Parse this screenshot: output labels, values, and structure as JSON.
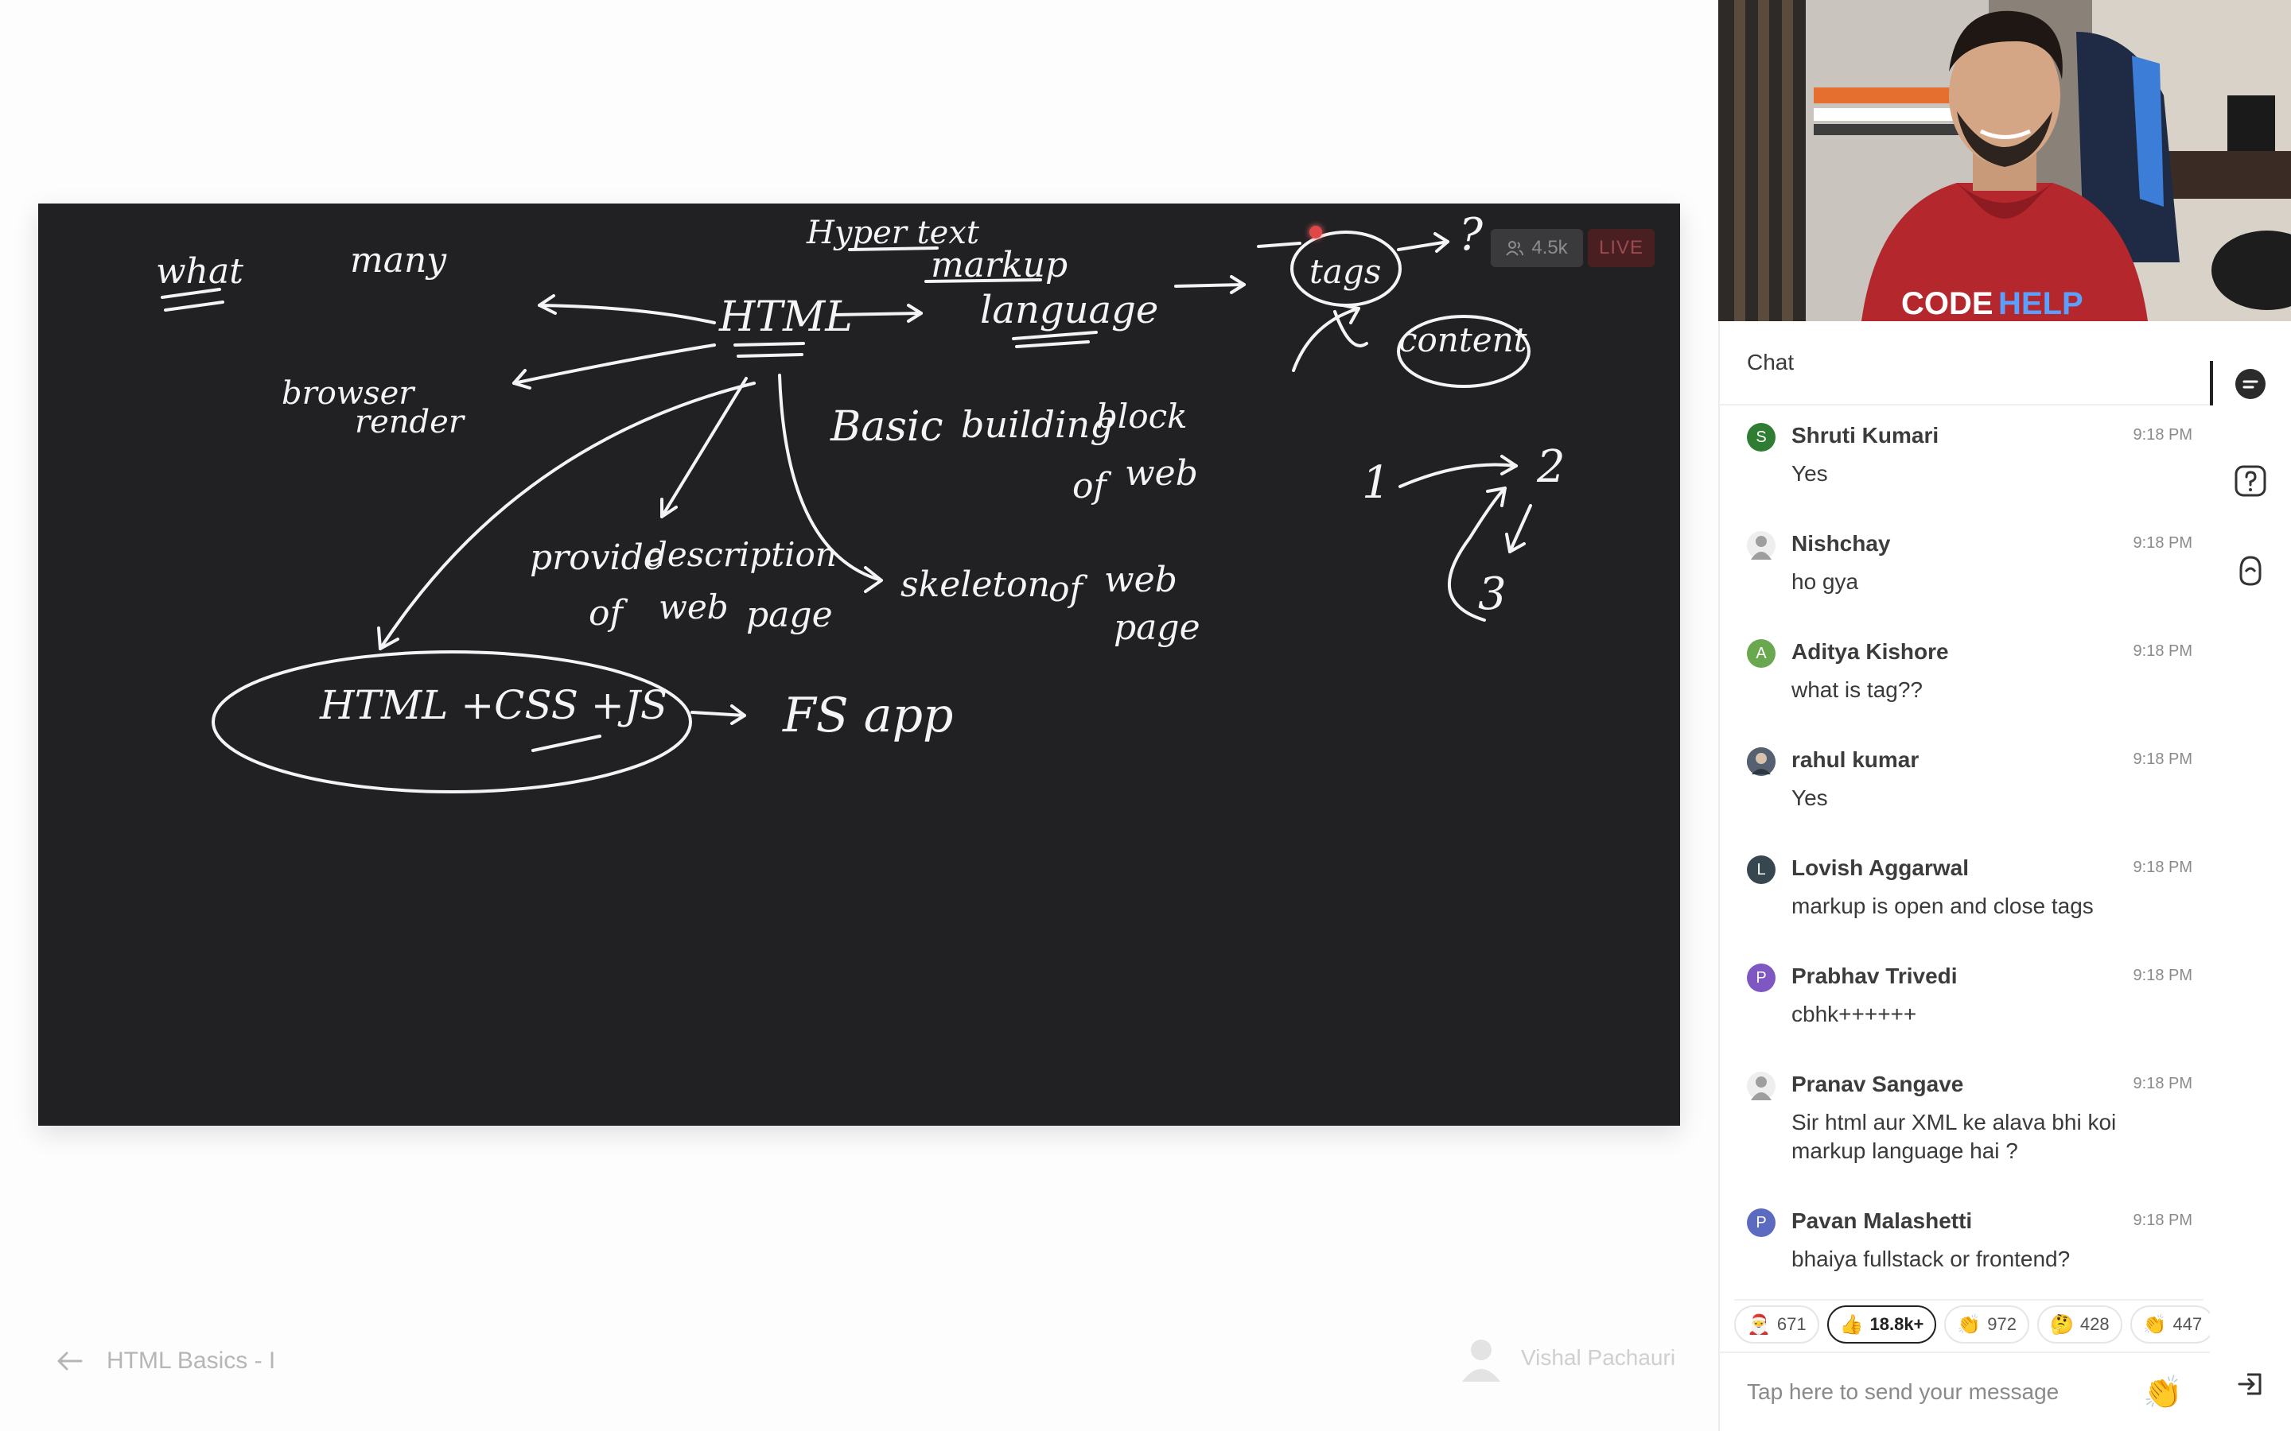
{
  "board": {
    "viewer_count": "4.5k",
    "live_label": "LIVE"
  },
  "lesson": {
    "title": "HTML Basics - I",
    "instructor": "Vishal Pachauri"
  },
  "video": {
    "logo_text_left": "CODE",
    "logo_text_right": "HELP"
  },
  "chat": {
    "title": "Chat",
    "messages": [
      {
        "initial": "S",
        "name": "Shruti Kumari",
        "time": "9:18 PM",
        "text": "Yes",
        "color": "#2e7d32"
      },
      {
        "initial": "",
        "name": "Nishchay",
        "time": "9:18 PM",
        "text": "ho gya",
        "color": "#9e9e9e"
      },
      {
        "initial": "A",
        "name": "Aditya Kishore",
        "time": "9:18 PM",
        "text": "what is tag??",
        "color": "#6aa84f"
      },
      {
        "initial": "",
        "name": "rahul kumar",
        "time": "9:18 PM",
        "text": "Yes",
        "color": "#556070"
      },
      {
        "initial": "L",
        "name": "Lovish Aggarwal",
        "time": "9:18 PM",
        "text": "markup is open and close tags",
        "color": "#37474f"
      },
      {
        "initial": "P",
        "name": "Prabhav Trivedi",
        "time": "9:18 PM",
        "text": "cbhk++++++",
        "color": "#7e57c2"
      },
      {
        "initial": "",
        "name": "Pranav Sangave",
        "time": "9:18 PM",
        "text": "Sir html aur XML ke alava bhi koi markup language hai ?",
        "color": "#9e9e9e"
      },
      {
        "initial": "P",
        "name": "Pavan Malashetti",
        "time": "9:18 PM",
        "text": "bhaiya fullstack or frontend?",
        "color": "#5c6bc0"
      }
    ],
    "reactions": [
      {
        "emoji": "🎅",
        "count": "671"
      },
      {
        "emoji": "👍",
        "count": "18.8k+"
      },
      {
        "emoji": "👏",
        "count": "972"
      },
      {
        "emoji": "🤔",
        "count": "428"
      },
      {
        "emoji": "👏",
        "count": "447"
      }
    ],
    "input_placeholder": "Tap here to send your message",
    "clap_emoji": "👏"
  },
  "board_notes": {
    "what": "what",
    "many": "many",
    "hyper_text": "Hyper text",
    "markup": "markup",
    "html": "HTML",
    "language": "language",
    "tags": "tags",
    "content": "content",
    "q": "?",
    "browser": "browser",
    "render": "render",
    "basic": "Basic",
    "building": "building",
    "block": "block",
    "of_web_1": "of",
    "web_1": "web",
    "provide": "provide",
    "description": "description",
    "of_2": "of",
    "web_2": "web",
    "page_1": "page",
    "skeleton": "skeleton",
    "of_3": "of",
    "web_3": "web",
    "page_2": "page",
    "n1": "1",
    "n2": "2",
    "n3": "3",
    "html_css_js": "HTML +CSS +JS",
    "fs_app": "FS app"
  }
}
